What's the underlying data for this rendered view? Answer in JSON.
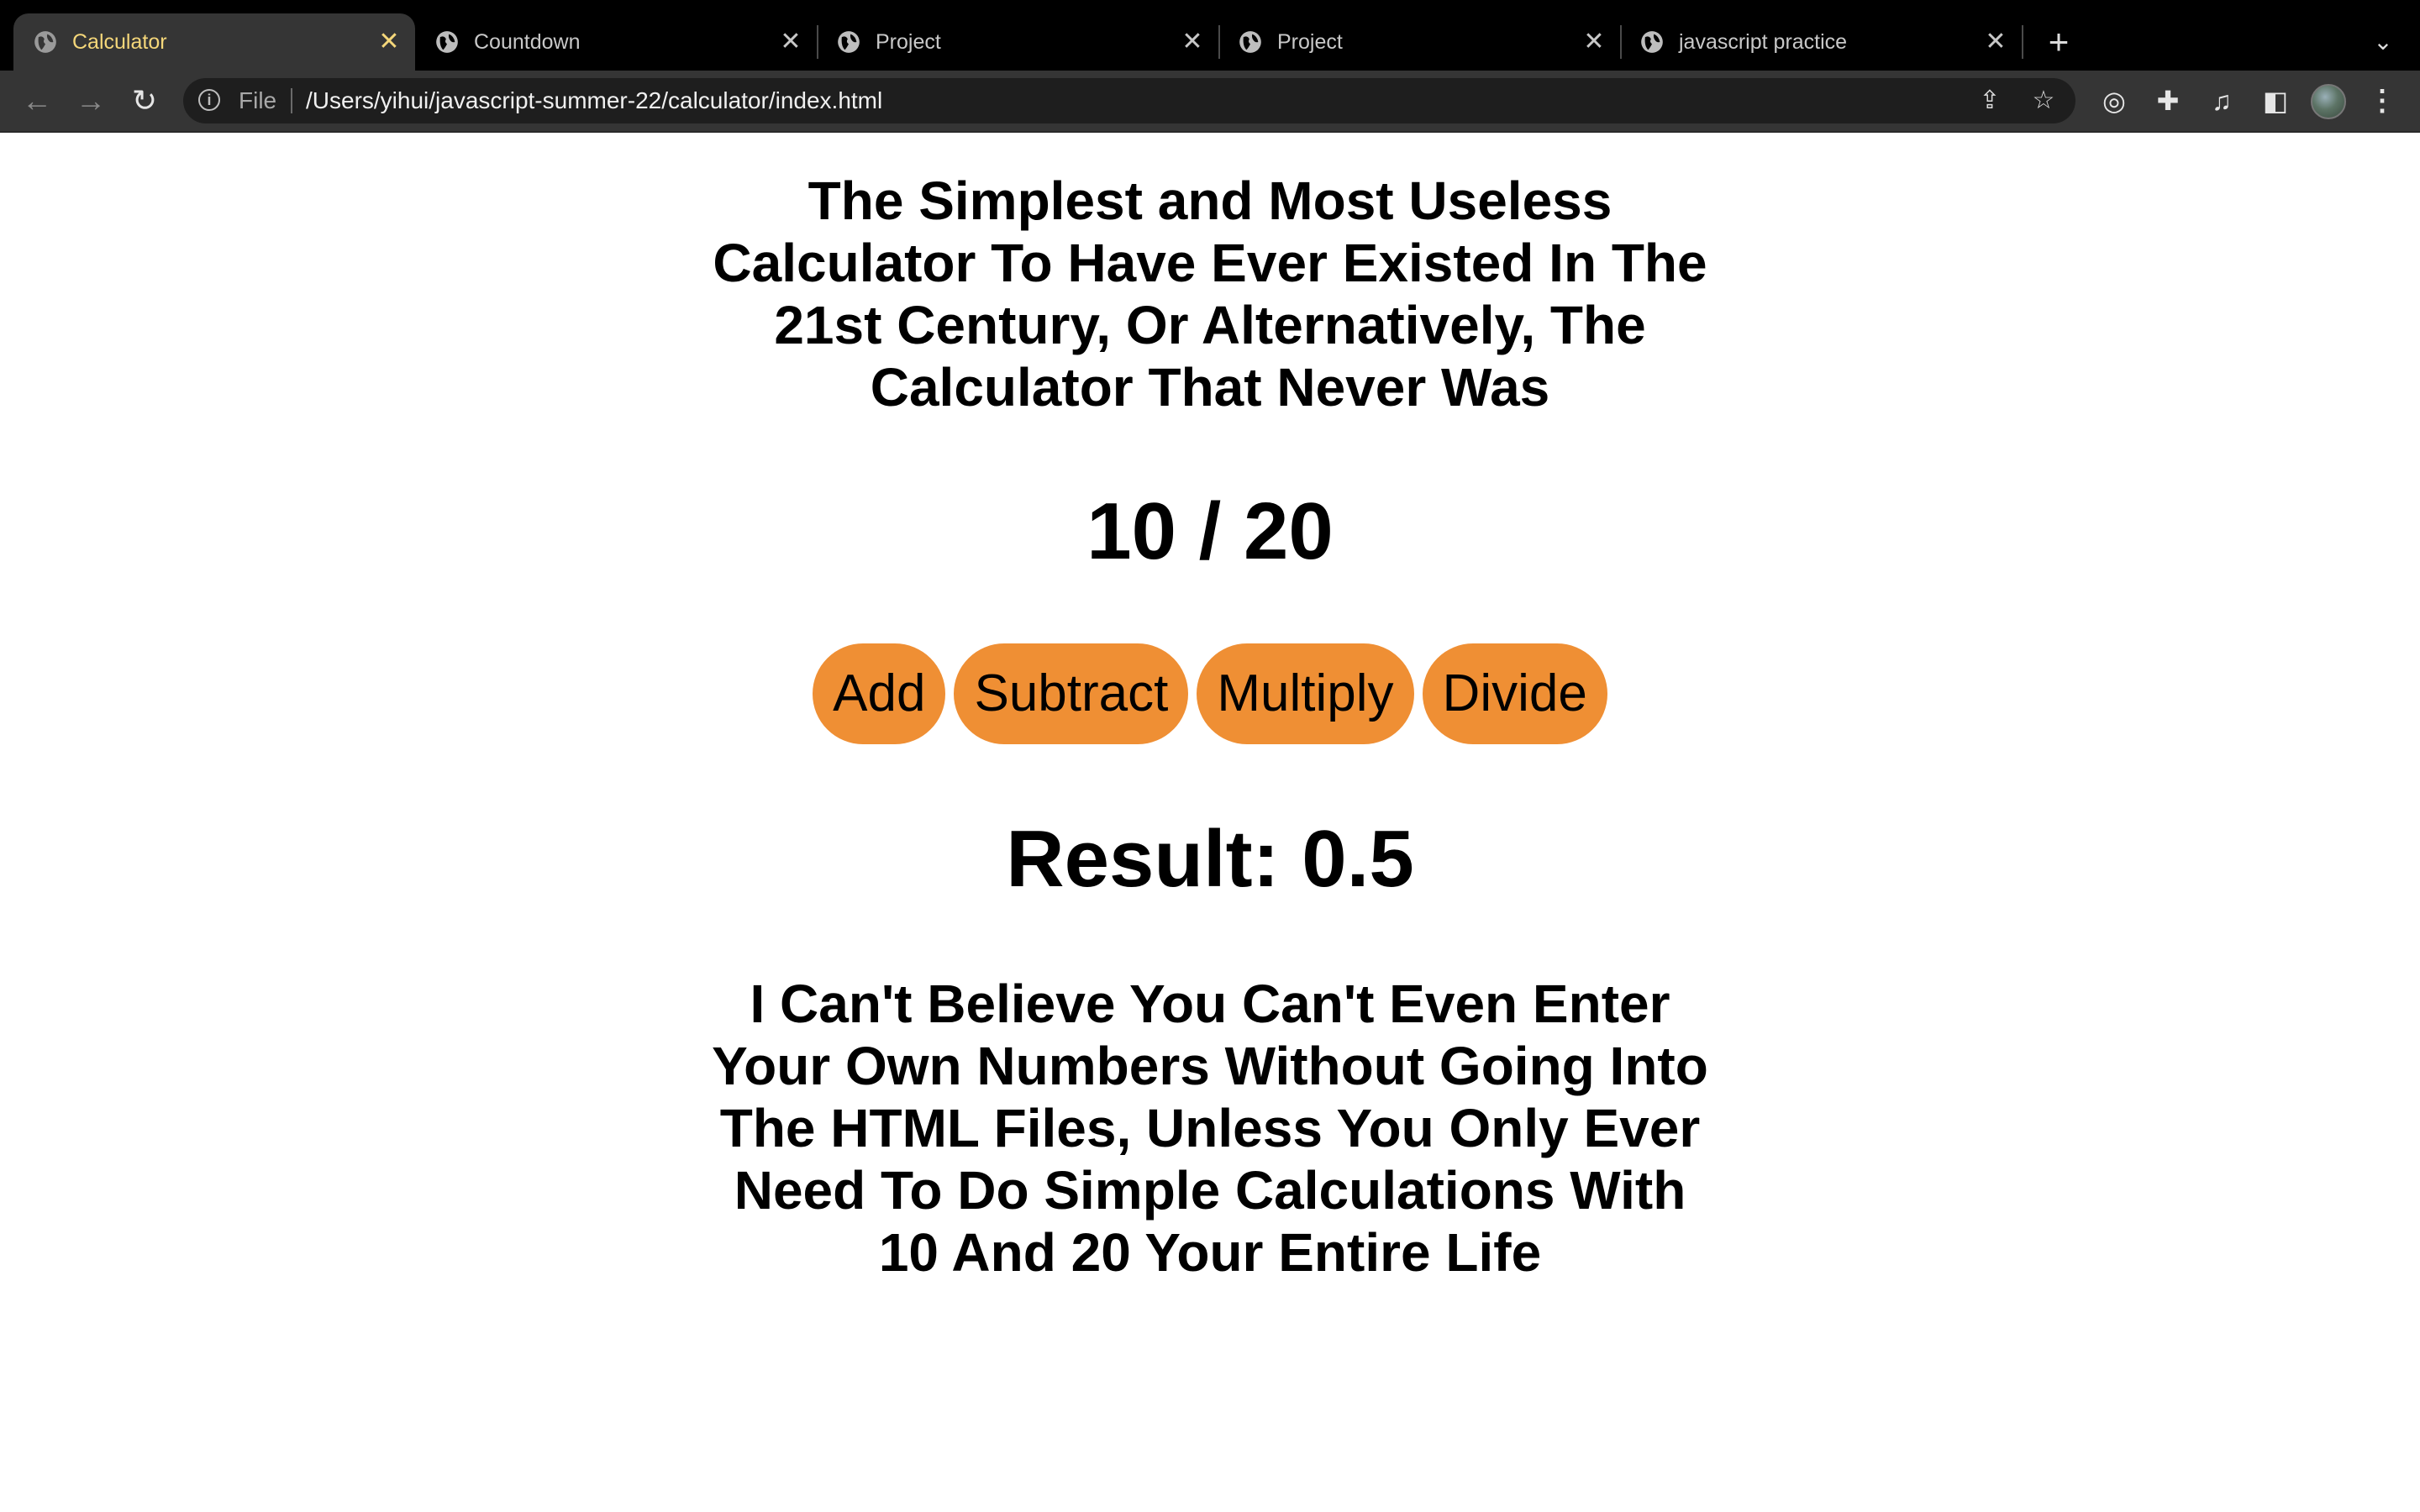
{
  "browser": {
    "tabs": [
      {
        "title": "Calculator",
        "active": true
      },
      {
        "title": "Countdown",
        "active": false
      },
      {
        "title": "Project",
        "active": false
      },
      {
        "title": "Project",
        "active": false
      },
      {
        "title": "javascript practice",
        "active": false
      }
    ],
    "close_glyph": "✕",
    "new_tab_glyph": "+",
    "tab_menu_glyph": "⌄",
    "nav": {
      "back": "←",
      "forward": "→",
      "reload": "↻"
    },
    "omnibox": {
      "info_glyph": "i",
      "scheme_label": "File",
      "url": "/Users/yihui/javascript-summer-22/calculator/index.html",
      "share_glyph": "⇪",
      "bookmark_glyph": "☆"
    },
    "toolbar_icons": {
      "eye_off": "◎",
      "extensions": "✚",
      "media": "♫",
      "side_panel": "◧",
      "menu": "⋮"
    },
    "accent_tab_text": "#f5d77a"
  },
  "page": {
    "title": "The Simplest and Most Useless Calculator To Have Ever Existed In The 21st Century, Or Alternatively, The Calculator That Never Was",
    "equation": "10 / 20",
    "buttons": {
      "add": "Add",
      "subtract": "Subtract",
      "multiply": "Multiply",
      "divide": "Divide"
    },
    "button_color": "#ef8f34",
    "result": "Result: 0.5",
    "footer": "I Can't Believe You Can't Even Enter Your Own Numbers Without Going Into The HTML Files, Unless You Only Ever Need To Do Simple Calculations With 10 And 20 Your Entire Life"
  }
}
